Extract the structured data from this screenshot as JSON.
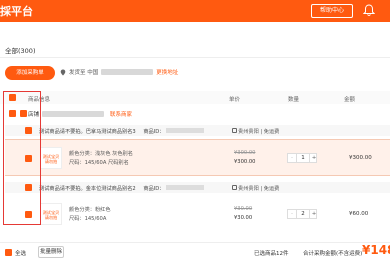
{
  "header": {
    "brand": "採平台",
    "help_label": "帮助中心",
    "accent": "#ff5a10"
  },
  "page": {
    "count_title": "全部(300)"
  },
  "toolbar": {
    "add_button": "添加采购单",
    "address_prefix": "发货至 中国",
    "address_change": "更换地址"
  },
  "table": {
    "headers": {
      "product": "商品信息",
      "unit_price": "单价",
      "quantity": "数量",
      "amount": "金额"
    }
  },
  "store": {
    "label": "店铺",
    "tag": "联系商家"
  },
  "groups": [
    {
      "title": "测试商品请不要拍。巴拿马测试商品别名3",
      "number_label": "商品ID：",
      "shipping": "贵州贵阳 | 免运费",
      "item": {
        "thumb_text": "测试宝贝请勿拍",
        "spec_line1": "颜色分类：浅灰色 灰色别名",
        "spec_line2": "尺码：145/60A 尺码别名",
        "price_old": "¥300.00",
        "price_new": "¥300.00",
        "quantity": "1",
        "amount": "¥300.00",
        "minus": "-",
        "plus": "+"
      }
    },
    {
      "title": "测试商品请不要拍。金本位测试商品别名2",
      "number_label": "商品ID：",
      "shipping": "贵州贵阳 | 免运费",
      "item": {
        "thumb_text": "测试宝贝请勿拍",
        "spec_line1": "颜色分类：粉红色",
        "spec_line2": "尺码：145/60A",
        "price_old": "¥30.00",
        "price_new": "¥30.00",
        "quantity": "2",
        "amount": "¥60.00",
        "minus": "-",
        "plus": "+"
      }
    }
  ],
  "footer": {
    "select_all": "全选",
    "batch_delete": "批量删除",
    "selected_count": "已选商品12件",
    "total_label": "合计采购金额(不含运费)",
    "total": "¥148"
  }
}
